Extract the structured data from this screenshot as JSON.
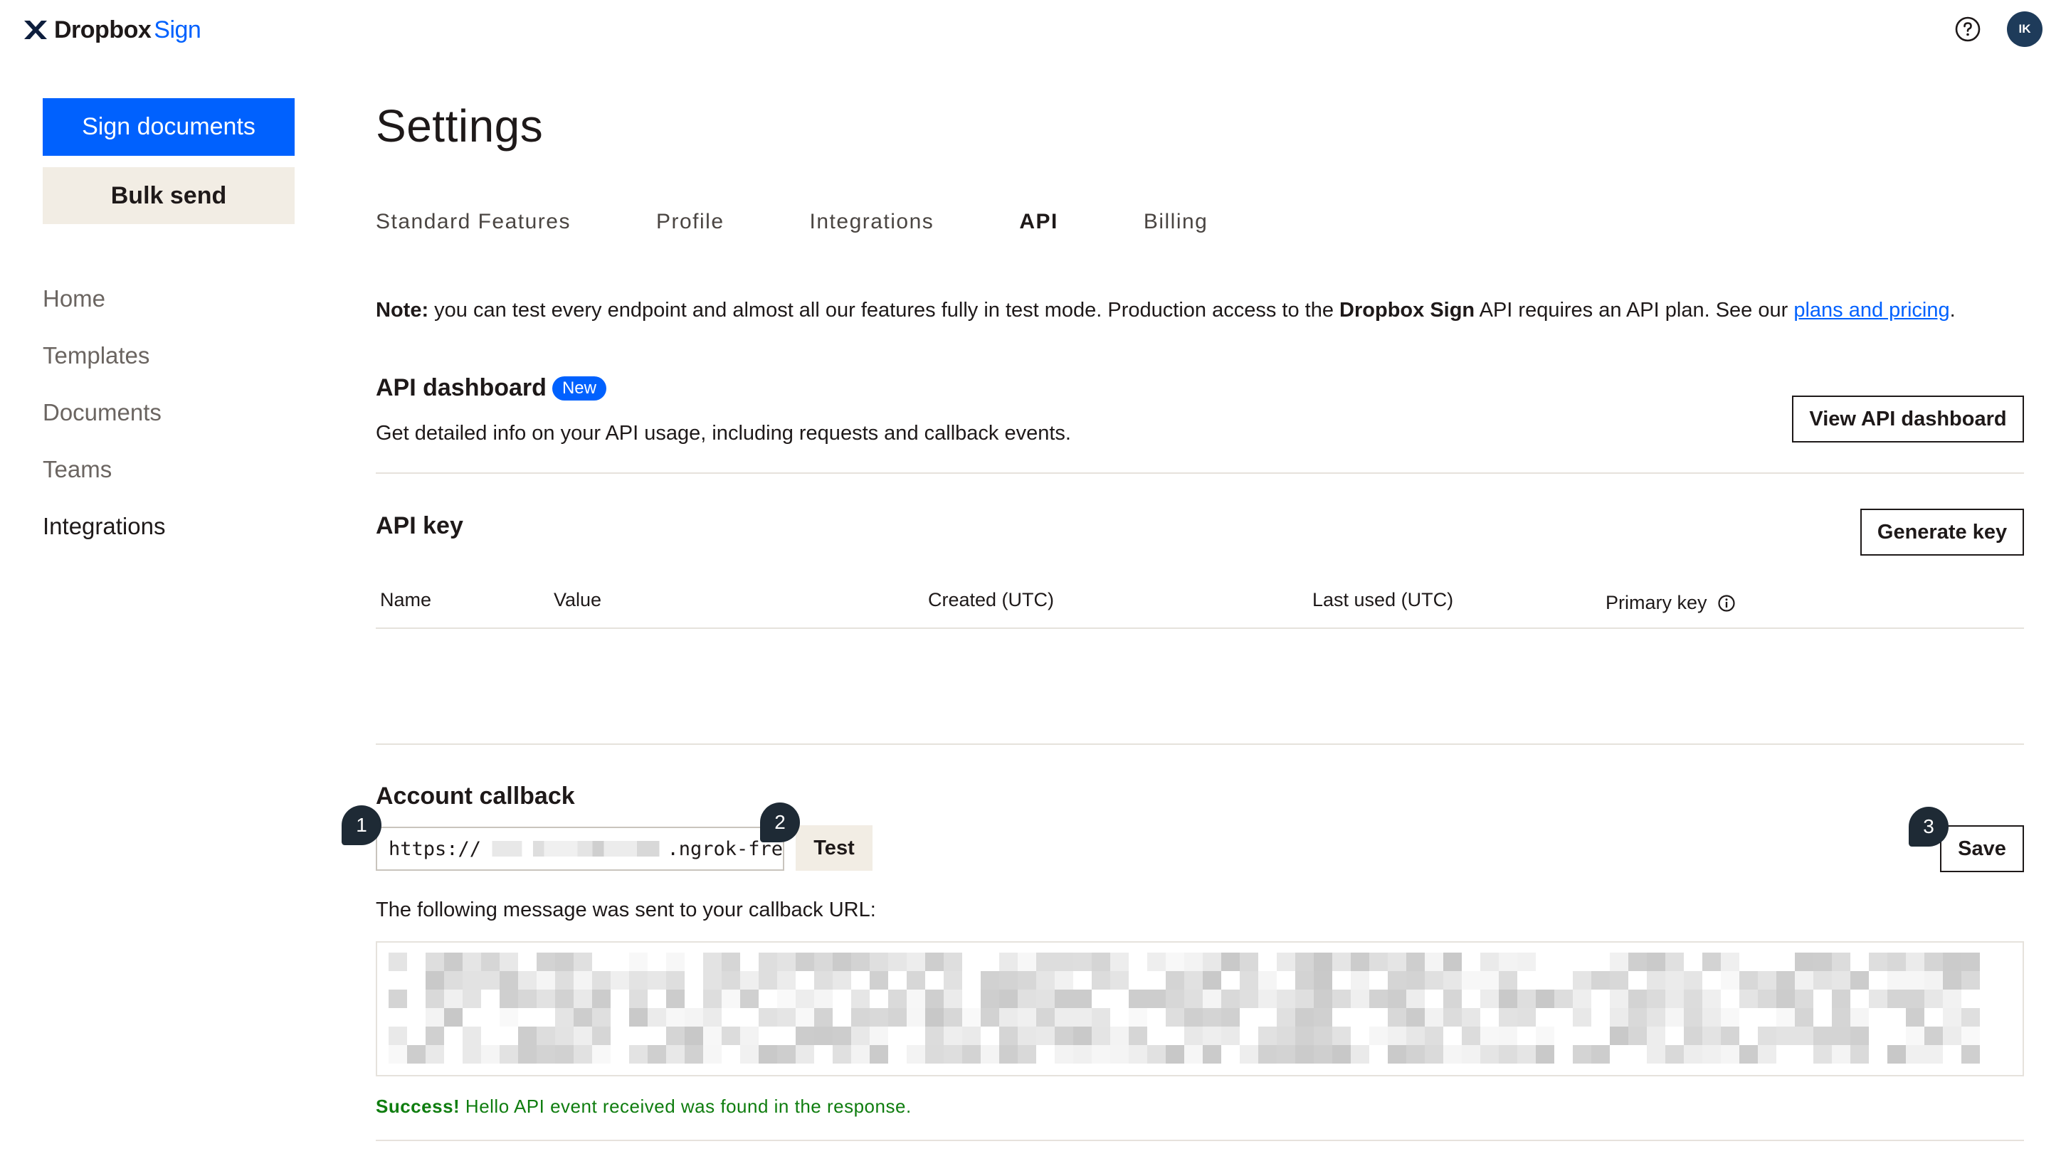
{
  "brand": {
    "name": "Dropbox",
    "product": "Sign"
  },
  "topbar": {
    "help_icon": "help-circle-icon",
    "avatar_initials": "IK"
  },
  "sidebar": {
    "primary_button": "Sign documents",
    "secondary_button": "Bulk send",
    "items": [
      {
        "label": "Home",
        "active": false
      },
      {
        "label": "Templates",
        "active": false
      },
      {
        "label": "Documents",
        "active": false
      },
      {
        "label": "Teams",
        "active": false
      },
      {
        "label": "Integrations",
        "active": true
      }
    ]
  },
  "page": {
    "title": "Settings",
    "tabs": [
      {
        "label": "Standard Features",
        "active": false
      },
      {
        "label": "Profile",
        "active": false
      },
      {
        "label": "Integrations",
        "active": false
      },
      {
        "label": "API",
        "active": true
      },
      {
        "label": "Billing",
        "active": false
      }
    ]
  },
  "note": {
    "prefix": "Note:",
    "text1": " you can test every endpoint and almost all our features fully in test mode. Production access to the ",
    "brand": "Dropbox Sign",
    "text2": " API requires an API plan. See our ",
    "link": "plans and pricing",
    "suffix": "."
  },
  "api_dashboard": {
    "title": "API dashboard",
    "badge": "New",
    "description": "Get detailed info on your API usage, including requests and callback events.",
    "button": "View API dashboard"
  },
  "api_key": {
    "title": "API key",
    "button": "Generate key",
    "columns": [
      "Name",
      "Value",
      "Created (UTC)",
      "Last used (UTC)",
      "Primary key"
    ]
  },
  "callback": {
    "title": "Account callback",
    "url_prefix": "https://",
    "url_suffix": ".ngrok-fre",
    "test_button": "Test",
    "save_button": "Save",
    "markers": [
      "1",
      "2",
      "3"
    ],
    "message_label": "The following message was sent to your callback URL:",
    "success_strong": "Success!",
    "success_text": " Hello API event received was found in the response."
  },
  "colors": {
    "accent": "#0061fe",
    "beige": "#f2ede4",
    "success": "#0f7d0f",
    "marker": "#1e2a35"
  }
}
